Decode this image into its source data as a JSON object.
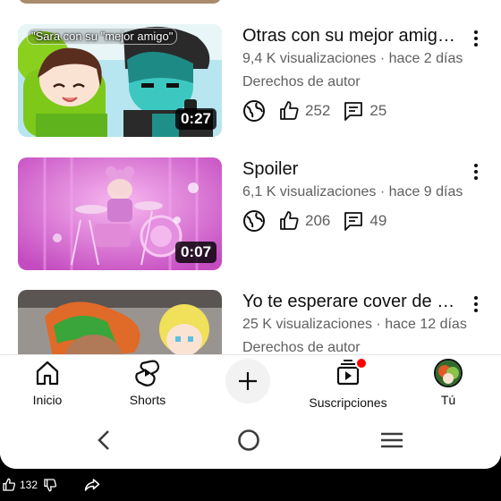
{
  "videos": [
    {
      "title": "Otras con su mejor amig…",
      "views": "9,4 K visualizaciones",
      "age": "hace 2 días",
      "rights": "Derechos de autor",
      "likes": "252",
      "comments": "25",
      "duration": "0:27",
      "thumb_caption": "\"Sara con su \"mejor amigo\""
    },
    {
      "title": "Spoiler",
      "views": "6,1 K visualizaciones",
      "age": "hace 9 días",
      "likes": "206",
      "comments": "49",
      "duration": "0:07"
    },
    {
      "title": "Yo te esperare cover de e…",
      "views": "25 K visualizaciones",
      "age": "hace 12 días",
      "rights": "Derechos de autor"
    }
  ],
  "meta_separator": "·",
  "bottom_nav": {
    "home": "Inicio",
    "shorts": "Shorts",
    "subscriptions": "Suscripciones",
    "you": "Tú"
  },
  "outer_bar": {
    "likes": "132"
  },
  "icons": [
    "globe-icon",
    "thumbs-up-icon",
    "comment-icon",
    "more-vert-icon",
    "home-icon",
    "shorts-icon",
    "plus-icon",
    "subscriptions-icon",
    "back-icon",
    "home-circle-icon",
    "recents-icon",
    "thumbs-down-icon",
    "share-icon"
  ],
  "colors": {
    "accent_red": "#ff0000",
    "text_primary": "#0f0f0f",
    "text_secondary": "#606060"
  }
}
